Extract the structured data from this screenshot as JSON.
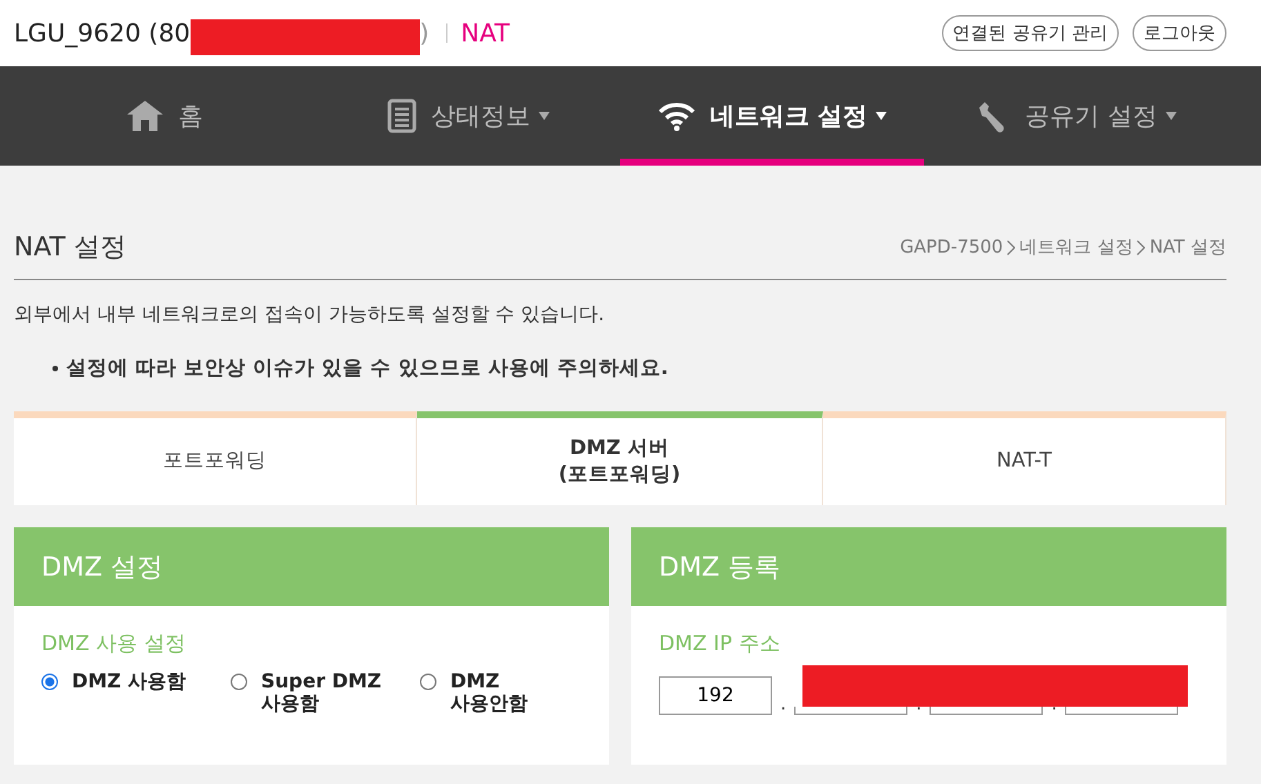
{
  "header": {
    "device_name": "LGU_9620 (80",
    "device_name_end": ")",
    "page_tag": "NAT",
    "buttons": [
      "연결된 공유기 관리",
      "로그아웃"
    ]
  },
  "nav": [
    {
      "label": "홈",
      "kind": "home",
      "dropdown": false,
      "selected": false
    },
    {
      "label": "상태정보",
      "kind": "document",
      "dropdown": true,
      "selected": false
    },
    {
      "label": "네트워크 설정",
      "kind": "wifi",
      "dropdown": true,
      "selected": true
    },
    {
      "label": "공유기 설정",
      "kind": "wrench",
      "dropdown": true,
      "selected": false
    }
  ],
  "page_title": "NAT 설정",
  "breadcrumb": [
    "GAPD-7500",
    "네트워크 설정",
    "NAT 설정"
  ],
  "description": "외부에서 내부 네트워크로의 접속이 가능하도록 설정할 수 있습니다.",
  "notes": [
    "설정에 따라 보안상 이슈가 있을 수 있으므로 사용에 주의하세요."
  ],
  "tabs": [
    {
      "label": "포트포워딩",
      "selected": false
    },
    {
      "label": "DMZ 서버\n(포트포워딩)",
      "selected": true
    },
    {
      "label": "NAT-T",
      "selected": false
    }
  ],
  "dmz_settings": {
    "title": "DMZ 설정",
    "field_label": "DMZ 사용 설정",
    "options": [
      {
        "label": "DMZ 사용함",
        "selected": true
      },
      {
        "label": "Super DMZ\n사용함",
        "selected": false
      },
      {
        "label": "DMZ\n사용안함",
        "selected": false
      }
    ]
  },
  "dmz_register": {
    "title": "DMZ 등록",
    "field_label": "DMZ IP 주소",
    "ip_fields": [
      {
        "kind": "plain",
        "value": "192"
      },
      {
        "kind": "masked"
      },
      {
        "kind": "masked"
      },
      {
        "kind": "masked"
      }
    ],
    "separator": "."
  }
}
